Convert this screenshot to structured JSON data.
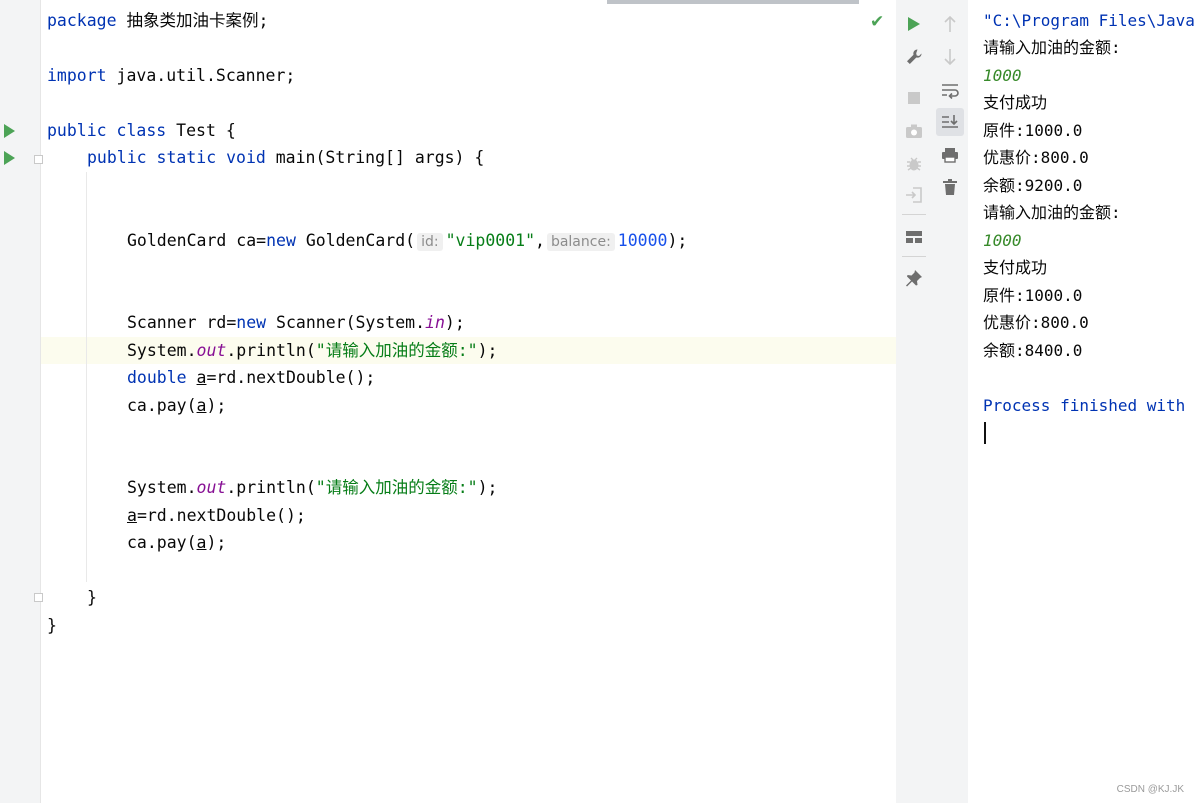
{
  "editor": {
    "lines": {
      "l1_kw": "package",
      "l1_rest": " 抽象类加油卡案例;",
      "l3_kw": "import",
      "l3_rest": " java.util.Scanner;",
      "l5_kw": "public class",
      "l5_rest": " Test {",
      "l6_kw": "public static void",
      "l6_rest": " main(String[] args) {",
      "l9_a": "GoldenCard ca=",
      "l9_new": "new",
      "l9_b": " GoldenCard(",
      "l9_hint1": "id:",
      "l9_str": "\"vip0001\"",
      "l9_comma": ",",
      "l9_hint2": "balance:",
      "l9_num": "10000",
      "l9_end": ");",
      "l12_a": "Scanner rd=",
      "l12_new": "new",
      "l12_b": " Scanner(System.",
      "l12_fld": "in",
      "l12_end": ");",
      "l13_a": "System.",
      "l13_fld": "out",
      "l13_b": ".println(",
      "l13_str": "\"请输入加油的金额:\"",
      "l13_end": ");",
      "l14_kw": "double",
      "l14_sp": " ",
      "l14_a": "a",
      "l14_rest": "=rd.nextDouble();",
      "l15_a": "ca.pay(",
      "l15_var": "a",
      "l15_end": ");",
      "l18_a": "System.",
      "l18_fld": "out",
      "l18_b": ".println(",
      "l18_str": "\"请输入加油的金额:\"",
      "l18_end": ");",
      "l19_var": "a",
      "l19_rest": "=rd.nextDouble();",
      "l20_a": "ca.pay(",
      "l20_var": "a",
      "l20_end": ");",
      "l22": "}",
      "l23": "}"
    }
  },
  "console": {
    "cmd": "\"C:\\Program Files\\Java",
    "prompt1": "请输入加油的金额:",
    "input1": "1000",
    "pay_ok1": "支付成功",
    "orig1": "原件:1000.0",
    "disc1": "优惠价:800.0",
    "bal1": "余额:9200.0",
    "prompt2": "请输入加油的金额:",
    "input2": "1000",
    "pay_ok2": "支付成功",
    "orig2": "原件:1000.0",
    "disc2": "优惠价:800.0",
    "bal2": "余额:8400.0",
    "finished": "Process finished with"
  },
  "watermark": "CSDN @KJ.JK",
  "colors": {
    "keyword": "#0033b3",
    "string": "#067d17",
    "number": "#1750eb",
    "field": "#871094",
    "run_green": "#4ca356",
    "console_input": "#378a2a"
  },
  "icons": {
    "editor": [
      "check-icon",
      "run-gutter-icon"
    ],
    "toolbar_left": [
      "run-icon",
      "wrench-icon",
      "stop-icon",
      "camera-icon",
      "debug-bug-icon",
      "login-icon",
      "layout-icon",
      "pin-icon"
    ],
    "toolbar_right": [
      "arrow-up-icon",
      "arrow-down-icon",
      "soft-wrap-icon",
      "scroll-to-end-icon",
      "print-icon",
      "trash-icon"
    ]
  }
}
